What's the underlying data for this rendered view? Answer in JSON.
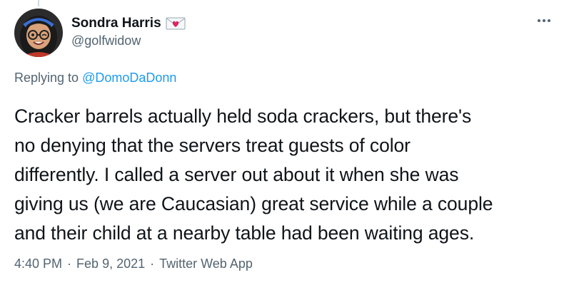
{
  "author": {
    "display_name": "Sondra Harris",
    "handle": "@golfwidow",
    "name_emoji": "love-letter-icon"
  },
  "reply": {
    "prefix": "Replying to",
    "mention": "@DomoDaDonn"
  },
  "tweet": {
    "lines": [
      "Cracker barrels actually held soda crackers, but there's",
      "no denying that the servers treat guests of color",
      "differently. I called a server out about it when she was",
      "giving us (we are Caucasian) great service while a couple",
      "and their child at a nearby table had been waiting ages."
    ]
  },
  "meta": {
    "time": "4:40 PM",
    "separator": "·",
    "date": "Feb 9, 2021",
    "source": "Twitter Web App"
  },
  "colors": {
    "text_primary": "#0f1419",
    "text_secondary": "#536471",
    "link": "#1d9bf0",
    "avatar_bg": "#2b2b2b"
  }
}
